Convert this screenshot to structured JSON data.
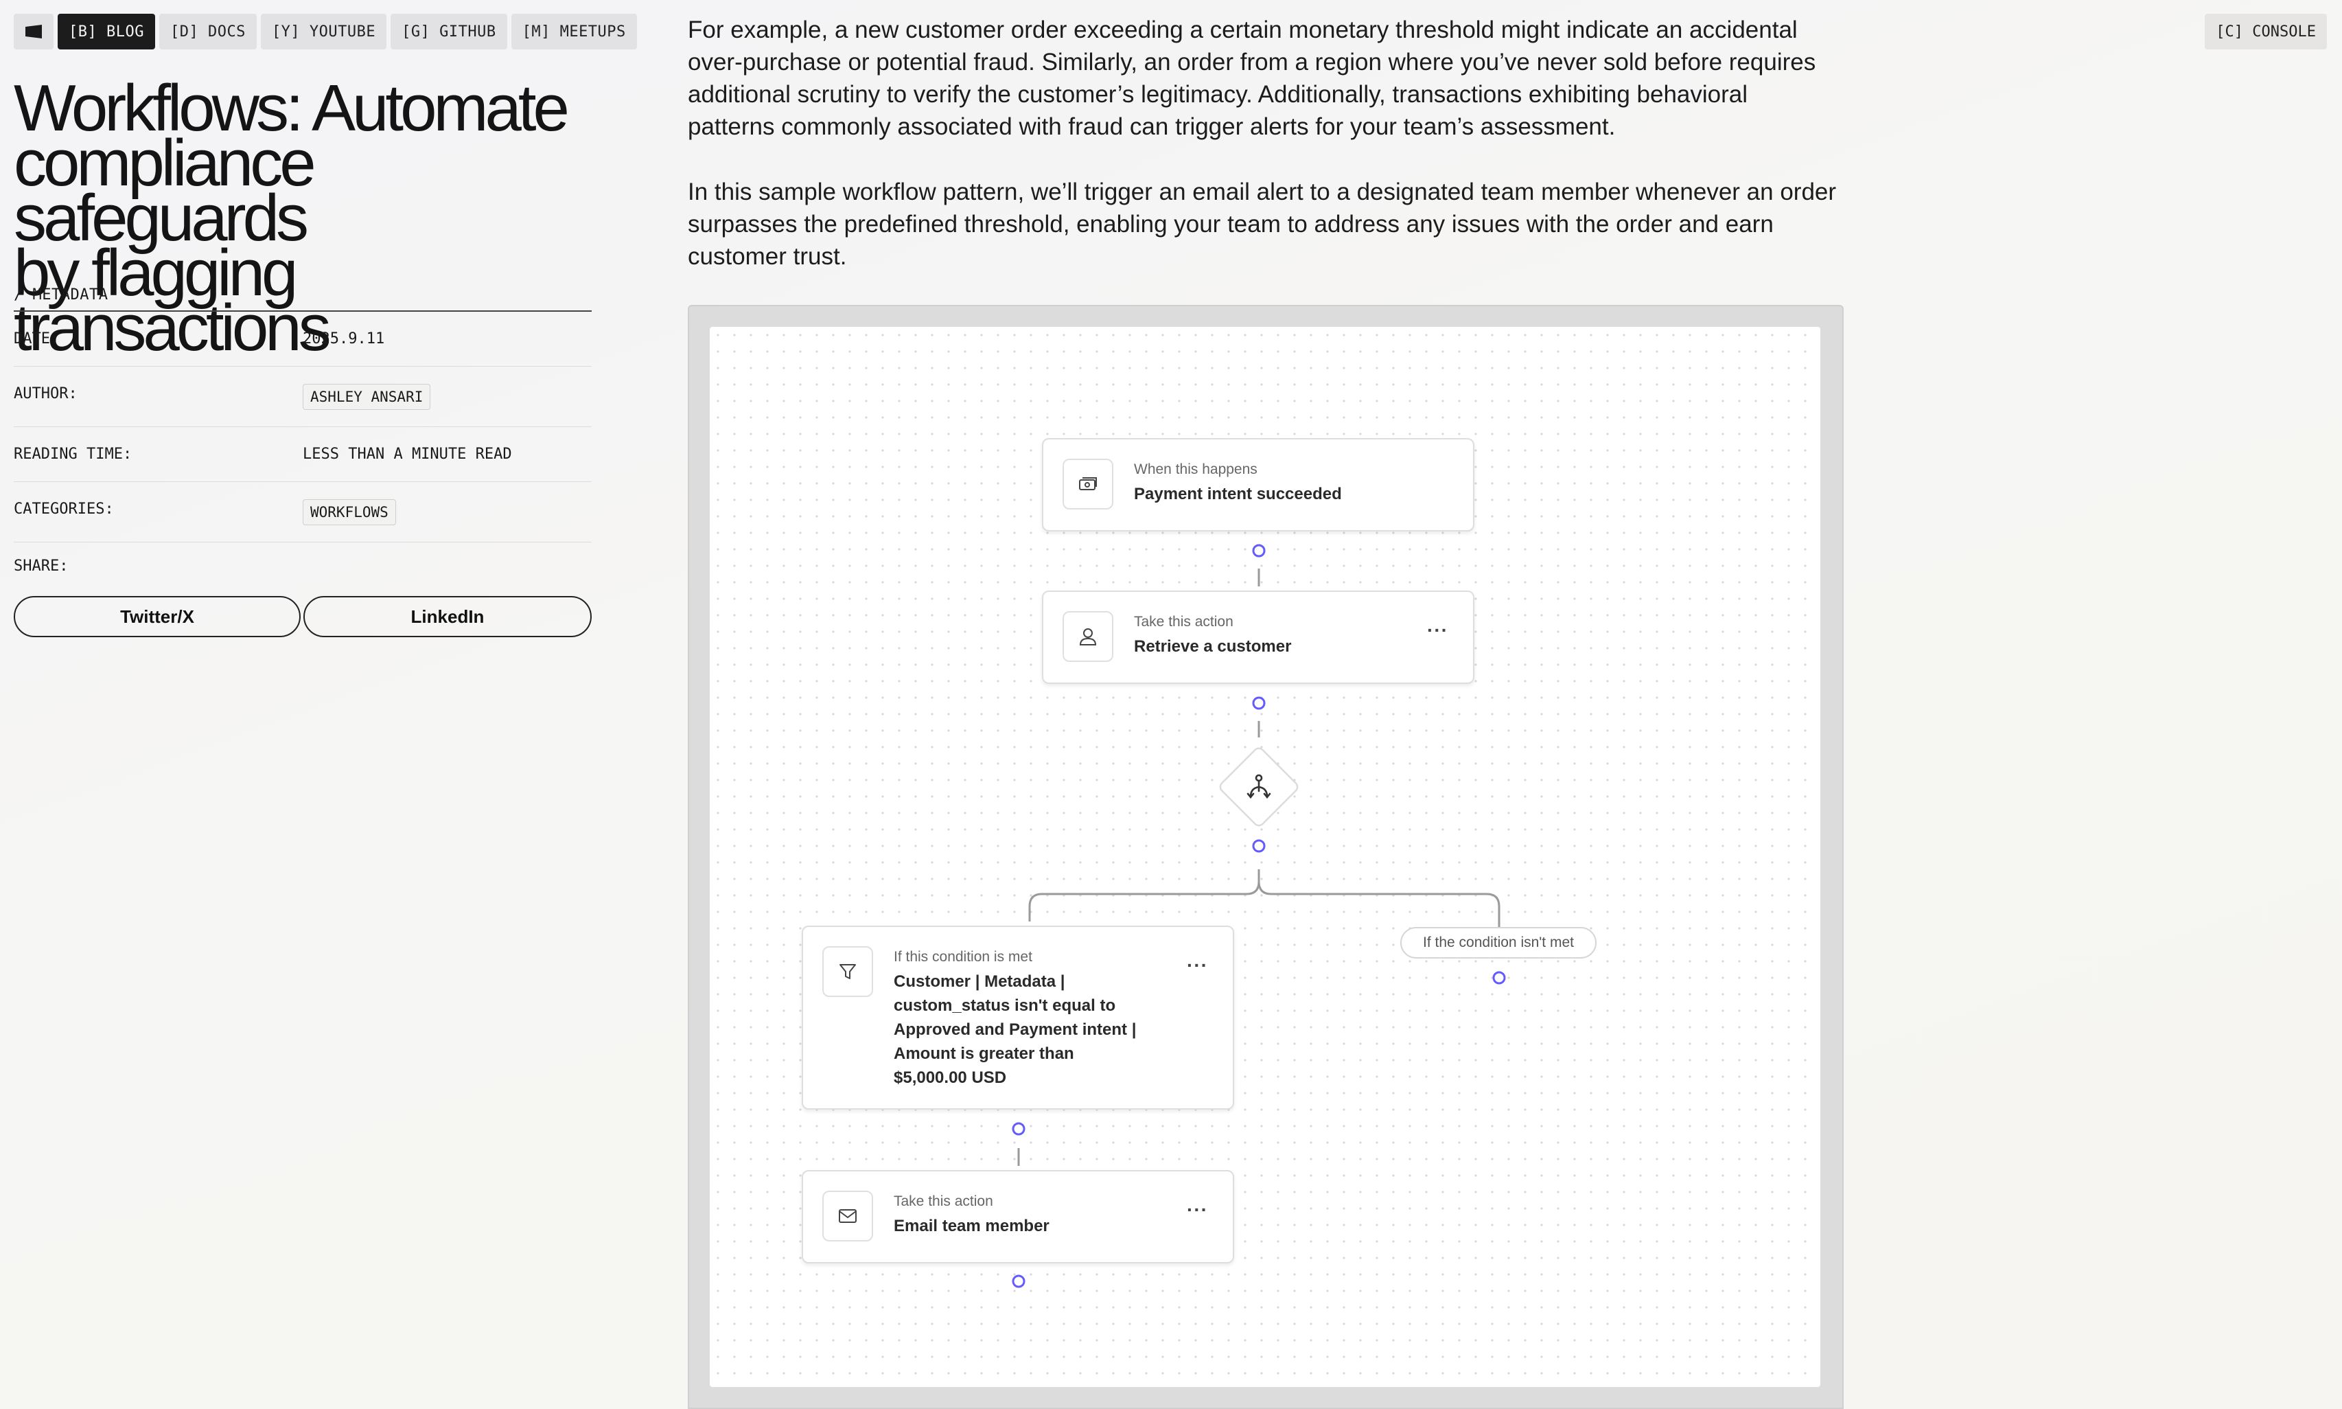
{
  "nav": {
    "items": [
      {
        "label": "[B] BLOG",
        "active": true
      },
      {
        "label": "[D] DOCS",
        "active": false
      },
      {
        "label": "[Y] YOUTUBE",
        "active": false
      },
      {
        "label": "[G] GITHUB",
        "active": false
      },
      {
        "label": "[M] MEETUPS",
        "active": false
      }
    ],
    "console_label": "[C] CONSOLE"
  },
  "article": {
    "title_lines": [
      "Workflows: Automate",
      "compliance safeguards",
      "by flagging transactions"
    ],
    "paragraphs": [
      [
        "For example, a new customer order exceeding a certain monetary threshold might indicate an accidental",
        "over-purchase or potential fraud. Similarly, an order from a region where you’ve never sold before requires",
        "additional scrutiny to verify the customer’s legitimacy. Additionally, transactions exhibiting behavioral",
        "patterns commonly associated with fraud can trigger alerts for your team’s assessment."
      ],
      [
        "In this sample workflow pattern, we’ll trigger an email alert to a designated team member whenever an order",
        "surpasses the predefined threshold, enabling your team to address any issues with the order and earn",
        "customer trust."
      ]
    ]
  },
  "metadata": {
    "header": "/ METADATA",
    "date_key": "DATE:",
    "date_value": "2025.9.11",
    "author_key": "AUTHOR:",
    "author_value": "ASHLEY ANSARI",
    "reading_key": "READING TIME:",
    "reading_value": "LESS THAN A MINUTE READ",
    "categories_key": "CATEGORIES:",
    "categories_value": "WORKFLOWS",
    "share_key": "SHARE:",
    "share_buttons": [
      "Twitter/X",
      "LinkedIn"
    ]
  },
  "workflow": {
    "trigger": {
      "sub": "When this happens",
      "main": "Payment intent succeeded",
      "icon": "payment-icon"
    },
    "retrieve": {
      "sub": "Take this action",
      "main": "Retrieve a customer",
      "icon": "user-icon"
    },
    "branch_icon": "branch-icon",
    "condition": {
      "sub": "If this condition is met",
      "main_lines": [
        "Customer | Metadata |",
        "custom_status isn't equal to",
        "Approved and Payment intent |",
        "Amount is greater than",
        "$5,000.00 USD"
      ],
      "icon": "filter-icon"
    },
    "else_label": "If the condition isn't met",
    "email": {
      "sub": "Take this action",
      "main": "Email team member",
      "icon": "mail-icon"
    },
    "more_label": "···",
    "accent": "#635bff"
  }
}
